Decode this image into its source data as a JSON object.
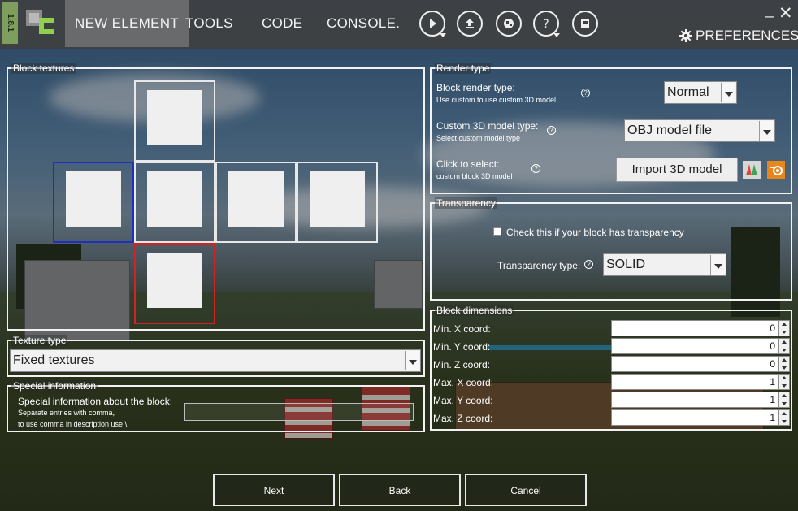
{
  "window": {
    "version": "1.8.1",
    "minimize_glyph": "_",
    "close_glyph": "✕"
  },
  "nav": {
    "items": [
      {
        "label": "NEW ELEMENT",
        "active": true
      },
      {
        "label": "TOOLS"
      },
      {
        "label": "CODE"
      },
      {
        "label": "CONSOLE."
      }
    ],
    "icons": [
      "run-icon",
      "export-icon",
      "mod-icon",
      "help-icon",
      "workspace-icon"
    ],
    "preferences": "PREFERENCES"
  },
  "block_textures": {
    "title": "Block textures"
  },
  "texture_type": {
    "title": "Texture type",
    "selected": "Fixed textures"
  },
  "special_info": {
    "title": "Special information",
    "label": "Special information about the block:",
    "hint_line1": "Separate entries with comma,",
    "hint_line2": "to use comma in description use \\,",
    "value": ""
  },
  "render_type": {
    "title": "Render type",
    "block_render_label": "Block render type:",
    "block_render_hint": "Use custom to use custom 3D model",
    "block_render_value": "Normal",
    "custom_model_label": "Custom 3D model type:",
    "custom_model_hint": "Select custom model type",
    "custom_model_value": "OBJ model file",
    "select_label": "Click to select:",
    "select_hint": "custom block 3D model",
    "import_button": "Import 3D model"
  },
  "transparency": {
    "title": "Transparency",
    "checkbox_label": "Check this if your block has transparency",
    "type_label": "Transparency type:",
    "type_value": "SOLID"
  },
  "dimensions": {
    "title": "Block dimensions",
    "fields": [
      {
        "label": "Min. X coord:",
        "value": "0"
      },
      {
        "label": "Min. Y coord:",
        "value": "0"
      },
      {
        "label": "Min. Z coord:",
        "value": "0"
      },
      {
        "label": "Max. X coord:",
        "value": "1"
      },
      {
        "label": "Max. Y coord:",
        "value": "1"
      },
      {
        "label": "Max. Z coord:",
        "value": "1"
      }
    ]
  },
  "footer": {
    "next": "Next",
    "back": "Back",
    "cancel": "Cancel"
  },
  "colors": {
    "accent_blue": "#1f2fc0",
    "accent_red": "#d02424",
    "version_green": "#7d9e5c"
  }
}
